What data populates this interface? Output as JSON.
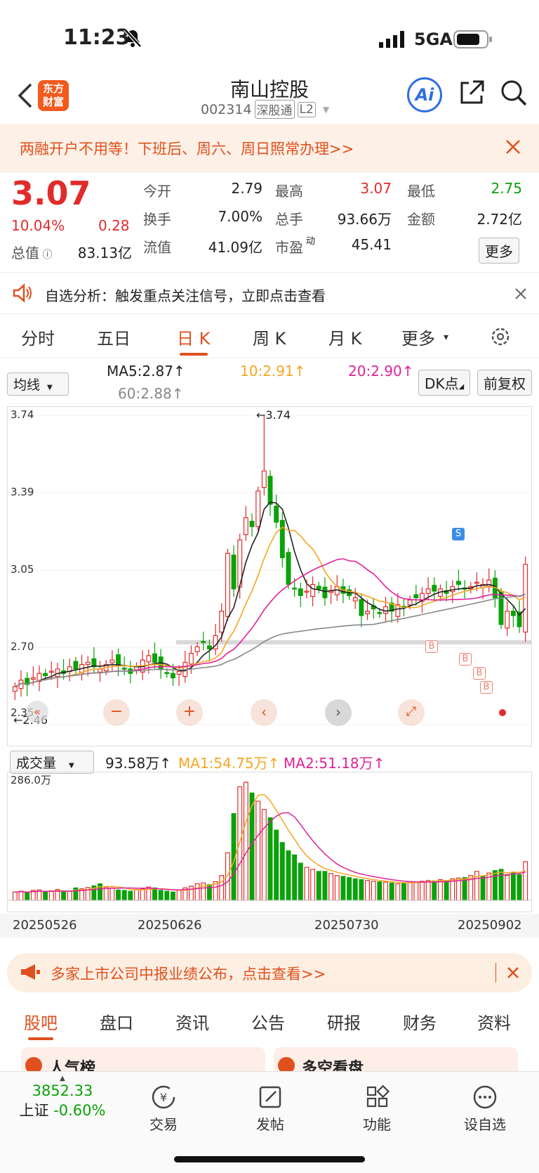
{
  "status_bar": {
    "time": "11:23",
    "network": "5GA"
  },
  "header": {
    "logo_line1": "东方",
    "logo_line2": "财富",
    "title": "南山控股",
    "code": "002314",
    "tag1": "深股通",
    "tag2": "L2",
    "ai_label": "Ai"
  },
  "banner": {
    "text": "两融开户不用等！下班后、周六、周日照常办理>>"
  },
  "quote": {
    "price": "3.07",
    "pct": "10.04%",
    "change": "0.28",
    "rows": [
      [
        {
          "label": "今开",
          "value": "2.79",
          "color": "#222"
        },
        {
          "label": "最高",
          "value": "3.07",
          "color": "#e12b2b"
        },
        {
          "label": "最低",
          "value": "2.75",
          "color": "#0aa20a"
        }
      ],
      [
        {
          "label": "换手",
          "value": "7.00%",
          "color": "#222"
        },
        {
          "label": "总手",
          "value": "93.66万",
          "color": "#222"
        },
        {
          "label": "金额",
          "value": "2.72亿",
          "color": "#222"
        }
      ],
      [
        {
          "label": "流值",
          "value": "41.09亿",
          "color": "#222"
        },
        {
          "label": "市盈",
          "sup": "动",
          "value": "45.41",
          "color": "#222"
        }
      ]
    ],
    "total_label": "总值",
    "total_value": "83.13亿",
    "more": "更多"
  },
  "alert": {
    "text": "自选分析：触发重点关注信号，立即点击查看"
  },
  "tabs": [
    "分时",
    "五日",
    "日 K",
    "周 K",
    "月 K",
    "更多"
  ],
  "active_tab": 2,
  "ma_bar": {
    "selector": "均线",
    "ma5": "MA5:2.87",
    "ma10": "10:2.91",
    "ma20": "20:2.90",
    "ma60": "60:2.88",
    "dk": "DK点",
    "fq": "前复权",
    "colors": {
      "ma5": "#222222",
      "ma10": "#f5a623",
      "ma20": "#e0229a",
      "ma60": "#888888"
    }
  },
  "kline": {
    "y_labels": [
      "3.74",
      "3.39",
      "3.05",
      "2.70",
      "2.35"
    ],
    "ylim": [
      2.35,
      3.74
    ],
    "high_label": "3.74",
    "low_label": "2.46",
    "signals": [
      {
        "text": "S",
        "color": "#3a8ee6"
      },
      {
        "text": "B",
        "color": "#f08070"
      },
      {
        "text": "B",
        "color": "#f08070"
      },
      {
        "text": "B",
        "color": "#f08070"
      },
      {
        "text": "B",
        "color": "#f08070"
      }
    ]
  },
  "volume": {
    "selector": "成交量",
    "value": "93.58万",
    "ma1": "MA1:54.75万",
    "ma2": "MA2:51.18万",
    "max_label": "286.0万"
  },
  "chart_data": {
    "type": "candlestick",
    "close": [
      2.52,
      2.55,
      2.53,
      2.56,
      2.58,
      2.57,
      2.59,
      2.6,
      2.58,
      2.61,
      2.6,
      2.62,
      2.63,
      2.61,
      2.6,
      2.62,
      2.64,
      2.62,
      2.6,
      2.58,
      2.61,
      2.64,
      2.66,
      2.63,
      2.6,
      2.58,
      2.56,
      2.59,
      2.63,
      2.67,
      2.7,
      2.72,
      2.69,
      2.75,
      2.86,
      3.12,
      2.96,
      3.18,
      3.28,
      3.24,
      3.4,
      3.49,
      3.34,
      3.26,
      3.1,
      2.98,
      2.96,
      2.93,
      2.95,
      2.98,
      2.96,
      2.92,
      2.95,
      2.97,
      2.94,
      2.93,
      2.92,
      2.84,
      2.86,
      2.87,
      2.85,
      2.88,
      2.86,
      2.89,
      2.88,
      2.91,
      2.92,
      2.94,
      2.96,
      2.95,
      2.96,
      2.94,
      2.97,
      2.98,
      2.96,
      2.97,
      2.99,
      2.98,
      3.0,
      2.92,
      2.8,
      2.86,
      2.84,
      2.79,
      3.07
    ],
    "volume_wan": [
      20,
      22,
      18,
      24,
      25,
      21,
      23,
      26,
      20,
      22,
      30,
      28,
      31,
      35,
      40,
      32,
      30,
      25,
      24,
      22,
      26,
      28,
      32,
      30,
      24,
      22,
      20,
      25,
      30,
      34,
      40,
      42,
      38,
      45,
      60,
      115,
      210,
      275,
      286,
      260,
      240,
      220,
      200,
      170,
      140,
      120,
      110,
      90,
      80,
      75,
      70,
      70,
      65,
      60,
      58,
      55,
      52,
      50,
      48,
      46,
      45,
      44,
      42,
      40,
      42,
      45,
      44,
      46,
      48,
      47,
      50,
      48,
      52,
      54,
      55,
      60,
      70,
      58,
      66,
      72,
      75,
      60,
      68,
      62,
      93.58
    ]
  },
  "x_dates": [
    "20250526",
    "20250626",
    "20250730",
    "20250902"
  ],
  "promo": {
    "text": "多家上市公司中报业绩公布，点击查看>>"
  },
  "bottom_tabs": [
    "股吧",
    "盘口",
    "资讯",
    "公告",
    "研报",
    "财务",
    "资料"
  ],
  "cards": [
    "人气榜",
    "多空看盘"
  ],
  "bottom_nav": {
    "index_value": "3852.33",
    "index_name": "上证",
    "index_pct": "-0.60%",
    "items": [
      "交易",
      "发帖",
      "功能",
      "设自选"
    ]
  }
}
